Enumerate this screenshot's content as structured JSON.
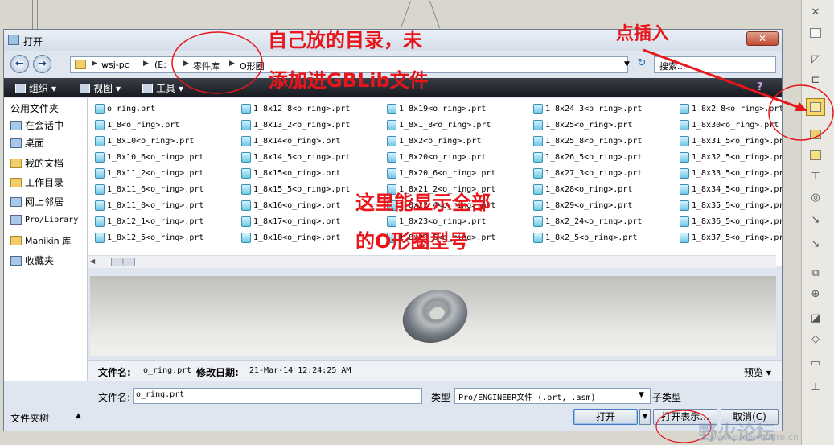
{
  "dialog": {
    "title": "打开",
    "address": {
      "crumbs": [
        "wsj-pc",
        "(E:",
        "零件库",
        "O形圈"
      ]
    },
    "search_placeholder": "搜索...",
    "toolbar": {
      "organize": "组织",
      "views": "视图",
      "tools": "工具"
    },
    "nav": {
      "header": "公用文件夹",
      "items": [
        {
          "label": "在会话中",
          "icon": "monitor-icon"
        },
        {
          "label": "桌面",
          "icon": "desktop-icon"
        },
        {
          "label": "我的文档",
          "icon": "documents-icon"
        },
        {
          "label": "工作目录",
          "icon": "working-dir-icon"
        },
        {
          "label": "网上邻居",
          "icon": "network-icon"
        },
        {
          "label": "Pro/Library",
          "icon": "library-icon"
        },
        {
          "label": "Manikin 库",
          "icon": "folder-icon"
        },
        {
          "label": "收藏夹",
          "icon": "favorites-icon"
        }
      ]
    },
    "files": [
      [
        "o_ring.prt",
        "1_8<o_ring>.prt",
        "1_8x10<o_ring>.prt",
        "1_8x10_6<o_ring>.prt",
        "1_8x11_2<o_ring>.prt",
        "1_8x11_6<o_ring>.prt",
        "1_8x11_8<o_ring>.prt",
        "1_8x12_1<o_ring>.prt",
        "1_8x12_5<o_ring>.prt"
      ],
      [
        "1_8x12_8<o_ring>.prt",
        "1_8x13_2<o_ring>.prt",
        "1_8x14<o_ring>.prt",
        "1_8x14_5<o_ring>.prt",
        "1_8x15<o_ring>.prt",
        "1_8x15_5<o_ring>.prt",
        "1_8x16<o_ring>.prt",
        "1_8x17<o_ring>.prt",
        "1_8x18<o_ring>.prt"
      ],
      [
        "1_8x19<o_ring>.prt",
        "1_8x1_8<o_ring>.prt",
        "1_8x2<o_ring>.prt",
        "1_8x20<o_ring>.prt",
        "1_8x20_6<o_ring>.prt",
        "1_8x21_2<o_ring>.prt",
        "1_8x22_4<o_ring>.prt",
        "1_8x23<o_ring>.prt",
        "1_8x23_6<o_ring>.prt"
      ],
      [
        "1_8x24_3<o_ring>.prt",
        "1_8x25<o_ring>.prt",
        "1_8x25_8<o_ring>.prt",
        "1_8x26_5<o_ring>.prt",
        "1_8x27_3<o_ring>.prt",
        "1_8x28<o_ring>.prt",
        "1_8x29<o_ring>.prt",
        "1_8x2_24<o_ring>.prt",
        "1_8x2_5<o_ring>.prt"
      ],
      [
        "1_8x2_8<o_ring>.prt",
        "1_8x30<o_ring>.prt",
        "1_8x31_5<o_ring>.prt",
        "1_8x32_5<o_ring>.prt",
        "1_8x33_5<o_ring>.prt",
        "1_8x34_5<o_ring>.prt",
        "1_8x35_5<o_ring>.prt",
        "1_8x36_5<o_ring>.prt",
        "1_8x37_5<o_ring>.prt"
      ]
    ],
    "details": {
      "name_label": "文件名:",
      "name_value": "o_ring.prt",
      "date_label": "修改日期:",
      "date_value": "21-Mar-14 12:24:25 AM",
      "preview_label": "预览"
    },
    "bottom": {
      "filename_label": "文件名:",
      "filename_value": "o_ring.prt",
      "type_label": "类型",
      "type_value": "Pro/ENGINEER文件 (.prt, .asm)",
      "subtype_label": "子类型",
      "folder_tree": "文件夹树",
      "open": "打开",
      "open_rep": "打开表示...",
      "cancel": "取消(C)"
    }
  },
  "annotations": {
    "line1": "自己放的目录，未",
    "line2": "添加进GBLib文件",
    "insert_hint": "点插入",
    "middle1": "这里能显示全部",
    "middle2": "的O形圈型号",
    "color": "#e8151b"
  },
  "watermark": {
    "site": "野火论坛",
    "url": "www.proewildfire.cn"
  }
}
